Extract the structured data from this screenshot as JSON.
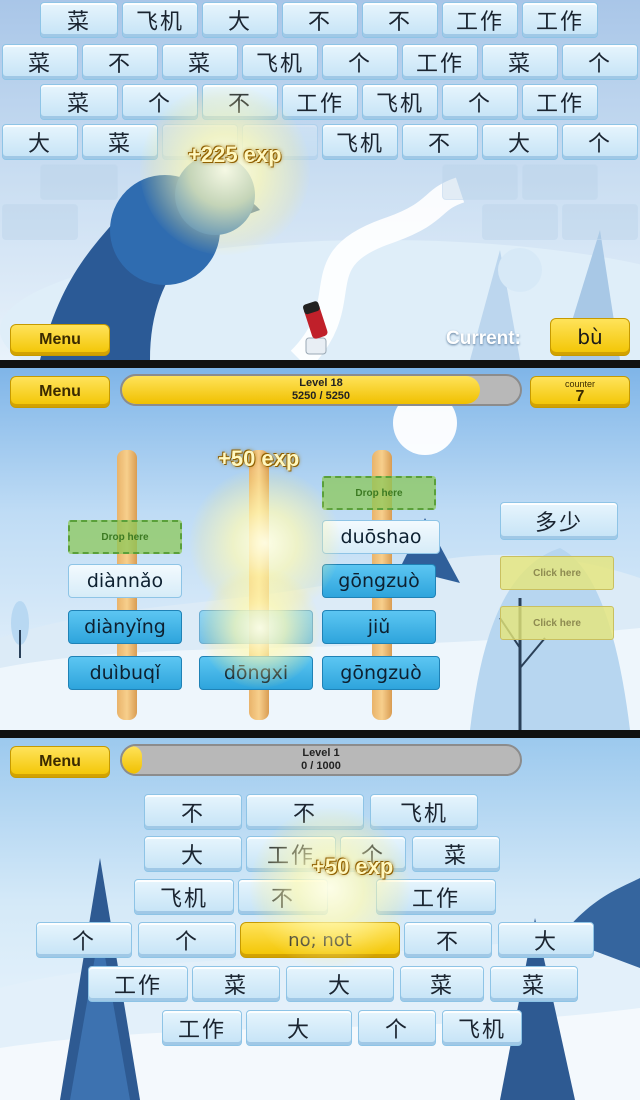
{
  "panel1": {
    "rows": [
      [
        "菜",
        "飞机",
        "大",
        "不",
        "不",
        "工作",
        "工作"
      ],
      [
        "菜",
        "不",
        "菜",
        "飞机",
        "个",
        "工作",
        "菜",
        "个"
      ],
      [
        "菜",
        "个",
        "不",
        "工作",
        "飞机",
        "个",
        "工作"
      ],
      [
        "大",
        "菜",
        "",
        "",
        "飞机",
        "不",
        "大",
        "个"
      ]
    ],
    "exp_popup": "+225 exp",
    "menu_label": "Menu",
    "current_label": "Current:",
    "current_value": "bù",
    "icons": [
      "cannon-icon"
    ]
  },
  "panel2": {
    "menu_label": "Menu",
    "level_label": "Level 18",
    "progress_text": "5250 / 5250",
    "progress_fraction": 0.9,
    "counter_label": "counter",
    "counter_value": "7",
    "exp_popup": "+50 exp",
    "drop_label": "Drop here",
    "click_label": "Click here",
    "columns": [
      [
        "diànnǎo",
        "diànyǐng",
        "duìbuqǐ"
      ],
      [
        "",
        "dōngxi"
      ],
      [
        "duōshao",
        "gōngzuò",
        "jiǔ",
        "gōngzuò"
      ]
    ],
    "prompt_character": "多少"
  },
  "panel3": {
    "menu_label": "Menu",
    "level_label": "Level 1",
    "progress_text": "0 / 1000",
    "progress_fraction": 0.05,
    "exp_popup": "+50 exp",
    "answer_label": "no; not",
    "rows": [
      [
        "不",
        "不",
        "飞机"
      ],
      [
        "大",
        "工作",
        "个",
        "菜"
      ],
      [
        "飞机",
        "不",
        "工作"
      ],
      [
        "个",
        "个",
        "",
        "不",
        "大"
      ],
      [
        "工作",
        "菜",
        "大",
        "菜",
        "菜"
      ],
      [
        "工作",
        "大",
        "个",
        "飞机"
      ]
    ]
  },
  "colors": {
    "accent": "#f2c400",
    "ice": "#c5e3f6",
    "pinyin": "#2ea4dc",
    "drop": "#8cc85a"
  }
}
